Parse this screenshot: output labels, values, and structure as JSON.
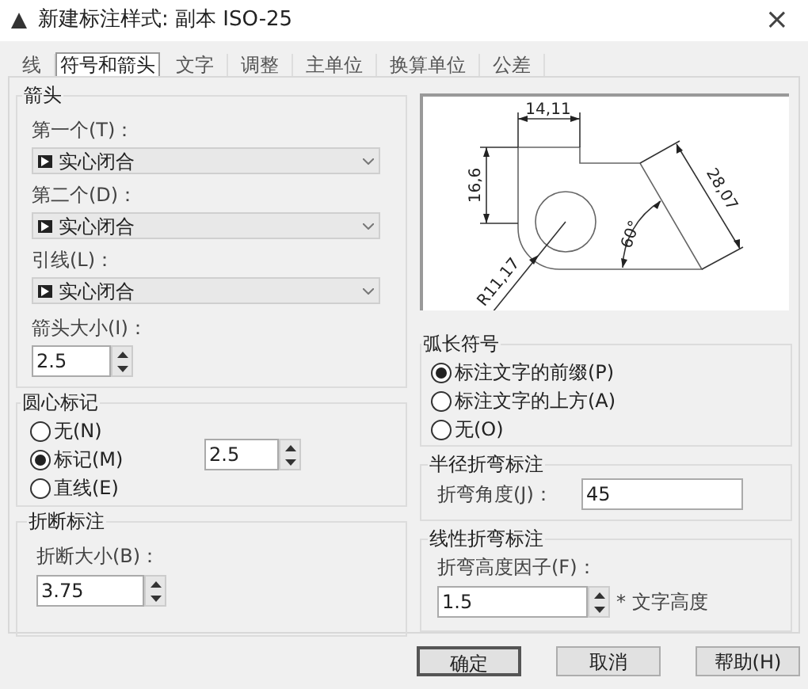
{
  "window": {
    "title": "新建标注样式: 副本 ISO-25",
    "close": "×"
  },
  "tabs": [
    {
      "label": "线",
      "selected": false
    },
    {
      "label": "符号和箭头",
      "selected": true
    },
    {
      "label": "文字",
      "selected": false
    },
    {
      "label": "调整",
      "selected": false
    },
    {
      "label": "主单位",
      "selected": false
    },
    {
      "label": "换算单位",
      "selected": false
    },
    {
      "label": "公差",
      "selected": false
    }
  ],
  "arrowheads": {
    "title": "箭头",
    "fields": [
      {
        "label": "第一个(T)：",
        "value": "实心闭合"
      },
      {
        "label": "第二个(D)：",
        "value": "实心闭合"
      },
      {
        "label": "引线(L)：",
        "value": "实心闭合"
      }
    ],
    "size": {
      "label": "箭头大小(I)：",
      "value": "2.5"
    }
  },
  "center_marks": {
    "title": "圆心标记",
    "options": [
      {
        "label": "无(N)",
        "selected": false
      },
      {
        "label": "标记(M)",
        "selected": true
      },
      {
        "label": "直线(E)",
        "selected": false
      }
    ],
    "size": "2.5"
  },
  "dimension_break": {
    "title": "折断标注",
    "label": "折断大小(B)：",
    "value": "3.75"
  },
  "preview": {
    "labels": [
      "14,11",
      "16,6",
      "28,07",
      "60°",
      "R11,17"
    ]
  },
  "arc_length": {
    "title": "弧长符号",
    "options": [
      {
        "label": "标注文字的前缀(P)",
        "selected": true
      },
      {
        "label": "标注文字的上方(A)",
        "selected": false
      },
      {
        "label": "无(O)",
        "selected": false
      }
    ]
  },
  "radius_jog": {
    "title": "半径折弯标注",
    "label": "折弯角度(J)：",
    "value": "45"
  },
  "linear_jog": {
    "title": "线性折弯标注",
    "label": "折弯高度因子(F)：",
    "value": "1.5",
    "suffix": "* 文字高度"
  },
  "buttons": [
    {
      "label": "确定",
      "default": true
    },
    {
      "label": "取消",
      "default": false
    },
    {
      "label": "帮助(H)",
      "default": false
    }
  ]
}
